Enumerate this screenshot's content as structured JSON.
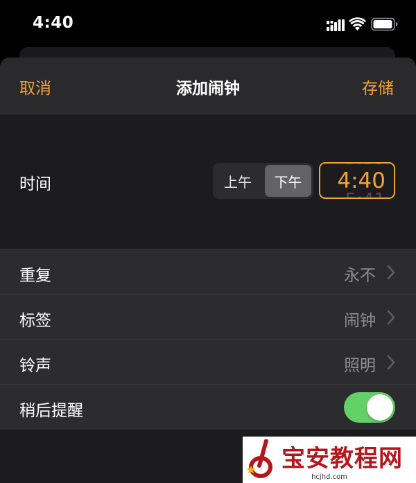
{
  "status_bar": {
    "time": "4:40",
    "icons": [
      "signal-icon",
      "wifi-icon",
      "battery-icon"
    ]
  },
  "nav": {
    "cancel_label": "取消",
    "title": "添加闹钟",
    "save_label": "存储"
  },
  "time": {
    "label": "时间",
    "am_label": "上午",
    "pm_label": "下午",
    "selected_period": "下午",
    "value": "4:40",
    "prev_value": "3:39",
    "next_value": "5:41"
  },
  "rows": [
    {
      "label": "重复",
      "value": "永不"
    },
    {
      "label": "标签",
      "value": "闹钟"
    },
    {
      "label": "铃声",
      "value": "照明"
    },
    {
      "label": "稍后提醒",
      "toggle_on": true
    }
  ],
  "watermark": {
    "title": "宝安教程网",
    "url": "hcjhd.com"
  },
  "colors": {
    "accent": "#f4a233",
    "toggle_on": "#63d068",
    "background": "#1c1c1e",
    "row_background": "#2c2c2e",
    "secondary_text": "#8e8e93",
    "watermark_red": "#b3171c"
  }
}
